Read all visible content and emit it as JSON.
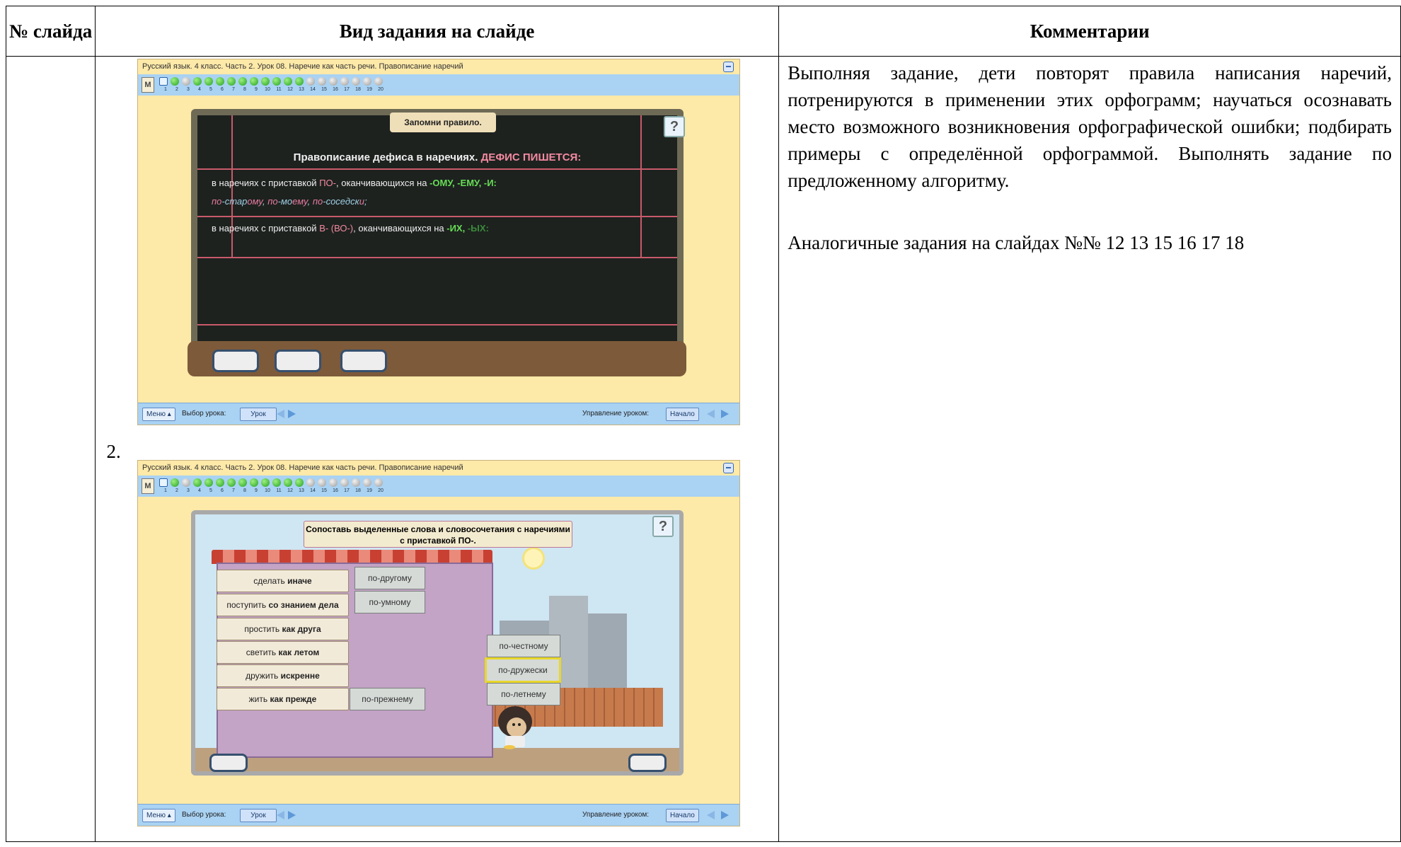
{
  "table": {
    "col1_header": "№ слайда",
    "col2_header": "Вид задания на слайде",
    "col3_header": "Комментарии",
    "slide_number": "2."
  },
  "comment": {
    "paragraph1": "Выполняя задание, дети повторят правила написания наречий, потренируются в применении этих орфограмм; научаться осознавать место возможного возникновения орфографической ошибки; подбирать примеры с определённой орфограммой. Выполнять задание по предложенному алгоритму.",
    "paragraph2": "Аналогичные задания на слайдах №№ 12 13 15 16 17 18"
  },
  "slide_ui": {
    "title": "Русский язык. 4 класс. Часть 2. Урок 08. Наречие как часть речи. Правописание наречий",
    "logo": "М",
    "lesson_numbers": [
      "1",
      "2",
      "3",
      "4",
      "5",
      "6",
      "7",
      "8",
      "9",
      "10",
      "11",
      "12",
      "13",
      "14",
      "15",
      "16",
      "17",
      "18",
      "19",
      "20"
    ],
    "menu_label": "Меню ▴",
    "lesson_choice_label": "Выбор урока:",
    "lesson_button": "Урок",
    "lesson_control_label": "Управление уроком:",
    "start_button": "Начало",
    "help_icon": "?"
  },
  "slide1": {
    "tag": "Запомни правило.",
    "heading": "Правописание дефиса в наречиях.",
    "heading_emph": "ДЕФИС ПИШЕТСЯ:",
    "line1_a": "в наречиях с приставкой",
    "line1_po": "ПО-",
    "line1_b": ", оканчивающихся на",
    "line1_endings": "-ОМУ, -ЕМУ, -И:",
    "line2_w1a": "по",
    "line2_w1b": "-стар",
    "line2_w1c": "ому",
    "line2_w2a": "по",
    "line2_w2b": "-мо",
    "line2_w2c": "ему",
    "line2_w3a": "по",
    "line2_w3b": "-соседск",
    "line2_w3c": "и",
    "line3_a": "в наречиях с приставкой",
    "line3_v": "В- (ВО-)",
    "line3_b": ", оканчивающихся на",
    "line3_endings": "-ИХ,",
    "line3_endings2": "-ЫХ:"
  },
  "slide2": {
    "task": "Сопоставь выделенные слова и словосочетания с наречиями с приставкой ПО-.",
    "rows": [
      {
        "plain": "сделать ",
        "bold": "иначе",
        "answer": "по-другому"
      },
      {
        "plain": "поступить ",
        "bold": "со знанием дела",
        "answer": "по-умному"
      },
      {
        "plain": "простить ",
        "bold": "как друга",
        "answer": ""
      },
      {
        "plain": "светить ",
        "bold": "как летом",
        "answer": ""
      },
      {
        "plain": "дружить ",
        "bold": "искренне",
        "answer": ""
      },
      {
        "plain": "жить ",
        "bold": "как прежде",
        "answer": "по-прежнему"
      }
    ],
    "loose_options": [
      "по-честному",
      "по-дружески",
      "по-летнему"
    ]
  },
  "colors": {
    "slide_bg": "#fde9a8",
    "nav_bar": "#a9d2f3",
    "chalk_pink": "#f58aa0",
    "chalk_green": "#66dd55",
    "board": "#1d221f"
  }
}
